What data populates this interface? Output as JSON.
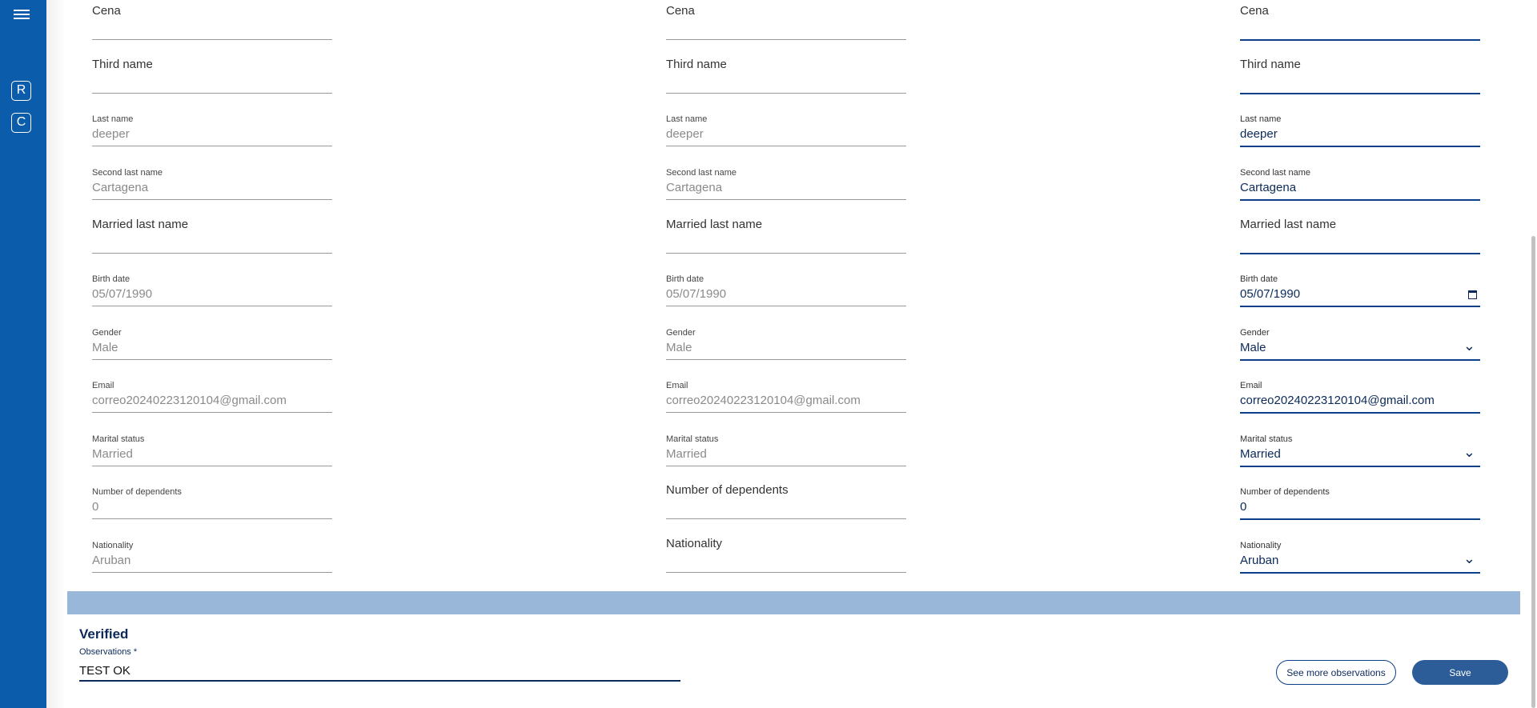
{
  "sidebar": {
    "icons": [
      "R",
      "C"
    ]
  },
  "columns": [
    {
      "mode": "readonly",
      "fields": [
        {
          "label": "",
          "value": "Cena"
        },
        {
          "label": "",
          "value": "Third name"
        },
        {
          "label": "Last name",
          "value": "deeper"
        },
        {
          "label": "Second last name",
          "value": "Cartagena"
        },
        {
          "label": "",
          "value": "Married last name"
        },
        {
          "label": "Birth date",
          "value": "05/07/1990"
        },
        {
          "label": "Gender",
          "value": "Male"
        },
        {
          "label": "Email",
          "value": "correo20240223120104@gmail.com"
        },
        {
          "label": "Marital status",
          "value": "Married"
        },
        {
          "label": "Number of dependents",
          "value": "0"
        },
        {
          "label": "Nationality",
          "value": "Aruban"
        }
      ]
    },
    {
      "mode": "readonly",
      "fields": [
        {
          "label": "",
          "value": "Cena"
        },
        {
          "label": "",
          "value": "Third name"
        },
        {
          "label": "Last name",
          "value": "deeper"
        },
        {
          "label": "Second last name",
          "value": "Cartagena"
        },
        {
          "label": "",
          "value": "Married last name"
        },
        {
          "label": "Birth date",
          "value": "05/07/1990"
        },
        {
          "label": "Gender",
          "value": "Male"
        },
        {
          "label": "Email",
          "value": "correo20240223120104@gmail.com"
        },
        {
          "label": "Marital status",
          "value": "Married"
        },
        {
          "label": "",
          "value": "Number of dependents"
        },
        {
          "label": "",
          "value": "Nationality"
        }
      ]
    },
    {
      "mode": "editable",
      "fields": [
        {
          "label": "",
          "value": "Cena"
        },
        {
          "label": "",
          "value": "Third name"
        },
        {
          "label": "Last name",
          "value": "deeper"
        },
        {
          "label": "Second last name",
          "value": "Cartagena"
        },
        {
          "label": "",
          "value": "Married last name"
        },
        {
          "label": "Birth date",
          "value": "05/07/1990",
          "icon": "calendar-icon"
        },
        {
          "label": "Gender",
          "value": "Male",
          "icon": "chevron-down-icon"
        },
        {
          "label": "Email",
          "value": "correo20240223120104@gmail.com"
        },
        {
          "label": "Marital status",
          "value": "Married",
          "icon": "chevron-down-icon"
        },
        {
          "label": "Number of dependents",
          "value": "0"
        },
        {
          "label": "Nationality",
          "value": "Aruban",
          "icon": "chevron-down-icon"
        }
      ]
    }
  ],
  "verification": {
    "title": "Verified",
    "observations_label": "Observations *",
    "observations_value": "TEST OK",
    "see_more_label": "See more observations",
    "save_label": "Save"
  },
  "colors": {
    "sidebar": "#0b5cab",
    "accent": "#0b2a5a",
    "bar": "#98b7d9",
    "primary_button": "#2d5d98"
  }
}
